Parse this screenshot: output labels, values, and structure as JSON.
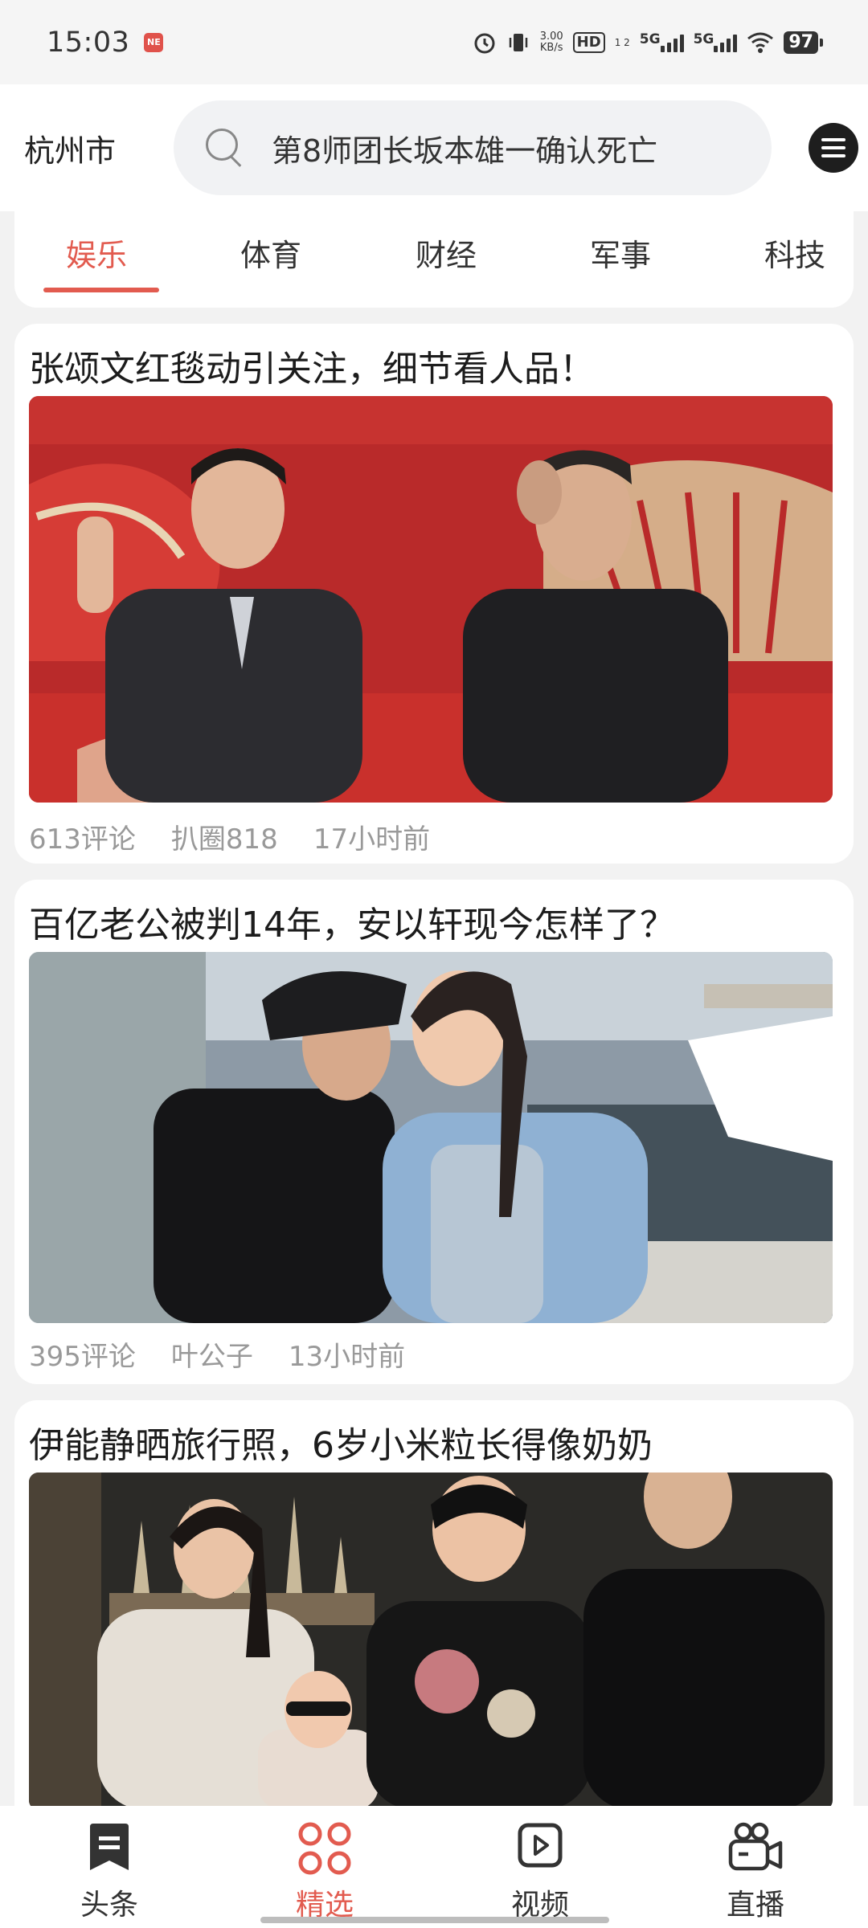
{
  "status_bar": {
    "time": "15:03",
    "notification_badge": "NE",
    "net_speed_value": "3.00",
    "net_speed_unit": "KB/s",
    "hd": "HD",
    "hd_sub": "1 2",
    "sig1": "5G",
    "sig2": "5G",
    "battery": "97"
  },
  "header": {
    "city": "杭州市",
    "search_placeholder": "第8师团长坂本雄一确认死亡"
  },
  "tabs": [
    {
      "label": "娱乐",
      "active": true
    },
    {
      "label": "体育",
      "active": false
    },
    {
      "label": "财经",
      "active": false
    },
    {
      "label": "军事",
      "active": false
    },
    {
      "label": "科技",
      "active": false
    }
  ],
  "articles": [
    {
      "title": "张颂文红毯动引关注，细节看人品！",
      "comments": "613评论",
      "source": "扒圈818",
      "time": "17小时前"
    },
    {
      "title": "百亿老公被判14年，安以轩现今怎样了？",
      "comments": "395评论",
      "source": "叶公子",
      "time": "13小时前"
    },
    {
      "title": "伊能静晒旅行照，6岁小米粒长得像奶奶"
    }
  ],
  "bottom_nav": [
    {
      "label": "头条",
      "active": false
    },
    {
      "label": "精选",
      "active": true
    },
    {
      "label": "视频",
      "active": false
    },
    {
      "label": "直播",
      "active": false
    }
  ],
  "colors": {
    "accent": "#e25b4f",
    "background": "#f2f2f2"
  }
}
